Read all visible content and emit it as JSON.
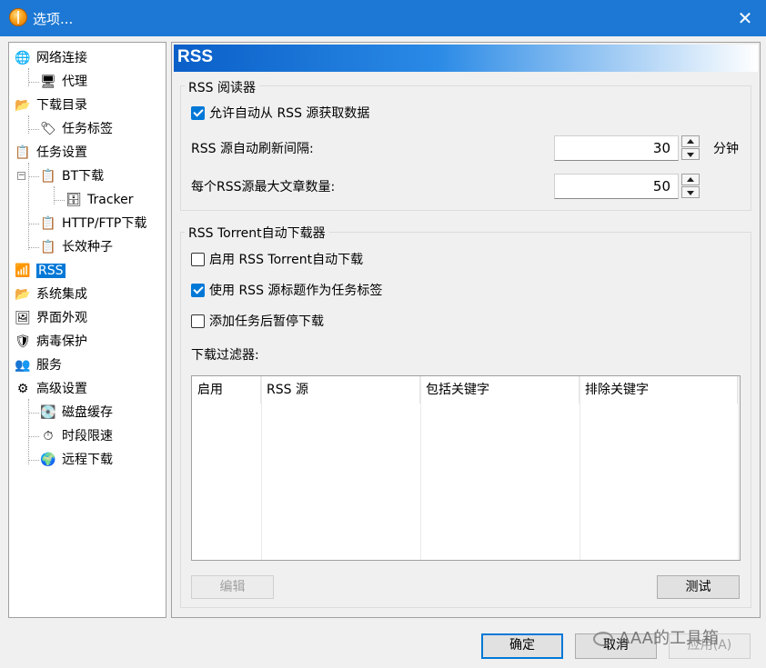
{
  "window": {
    "title": "选项...",
    "close_symbol": "✕"
  },
  "tree": [
    {
      "label": "网络连接",
      "icon": "globe-icon",
      "glyph": "🌐"
    },
    {
      "label": "代理",
      "icon": "proxy-icon",
      "glyph": "🖥"
    },
    {
      "label": "下载目录",
      "icon": "folder-icon",
      "glyph": "📂"
    },
    {
      "label": "任务标签",
      "icon": "tag-icon",
      "glyph": "🏷"
    },
    {
      "label": "任务设置",
      "icon": "clipboard-icon",
      "glyph": "📋"
    },
    {
      "label": "BT下载",
      "icon": "clipboard-icon",
      "glyph": "📋"
    },
    {
      "label": "Tracker",
      "icon": "server-icon",
      "glyph": "🗄"
    },
    {
      "label": "HTTP/FTP下载",
      "icon": "clipboard-icon",
      "glyph": "📋"
    },
    {
      "label": "长效种子",
      "icon": "clipboard-icon",
      "glyph": "📋"
    },
    {
      "label": "RSS",
      "icon": "rss-icon",
      "glyph": "📶"
    },
    {
      "label": "系统集成",
      "icon": "integration-icon",
      "glyph": "📂"
    },
    {
      "label": "界面外观",
      "icon": "appearance-icon",
      "glyph": "🖼"
    },
    {
      "label": "病毒保护",
      "icon": "shield-icon",
      "glyph": "🛡"
    },
    {
      "label": "服务",
      "icon": "users-icon",
      "glyph": "👥"
    },
    {
      "label": "高级设置",
      "icon": "advanced-icon",
      "glyph": "⚙"
    },
    {
      "label": "磁盘缓存",
      "icon": "disk-icon",
      "glyph": "💽"
    },
    {
      "label": "时段限速",
      "icon": "clock-icon",
      "glyph": "⏱"
    },
    {
      "label": "远程下载",
      "icon": "remote-globe-icon",
      "glyph": "🌍"
    }
  ],
  "panel": {
    "header": "RSS",
    "reader_group": {
      "title": "RSS 阅读器",
      "allow_auto_fetch": {
        "label": "允许自动从 RSS 源获取数据",
        "checked": true
      },
      "refresh_interval": {
        "label": "RSS 源自动刷新间隔:",
        "value": "30",
        "unit": "分钟"
      },
      "max_articles": {
        "label": "每个RSS源最大文章数量:",
        "value": "50"
      }
    },
    "downloader_group": {
      "title": "RSS Torrent自动下载器",
      "enable_auto_download": {
        "label": "启用 RSS Torrent自动下载",
        "checked": false
      },
      "use_title_as_tag": {
        "label": "使用 RSS 源标题作为任务标签",
        "checked": true
      },
      "pause_after_add": {
        "label": "添加任务后暂停下载",
        "checked": false
      },
      "filter_label": "下载过滤器:",
      "columns": [
        "启用",
        "RSS 源",
        "包括关键字",
        "排除关键字"
      ],
      "edit_button": "编辑",
      "test_button": "测试"
    }
  },
  "footer": {
    "ok": "确定",
    "cancel": "取消",
    "apply": "应用(A)"
  },
  "watermark": "AAA的工具箱"
}
